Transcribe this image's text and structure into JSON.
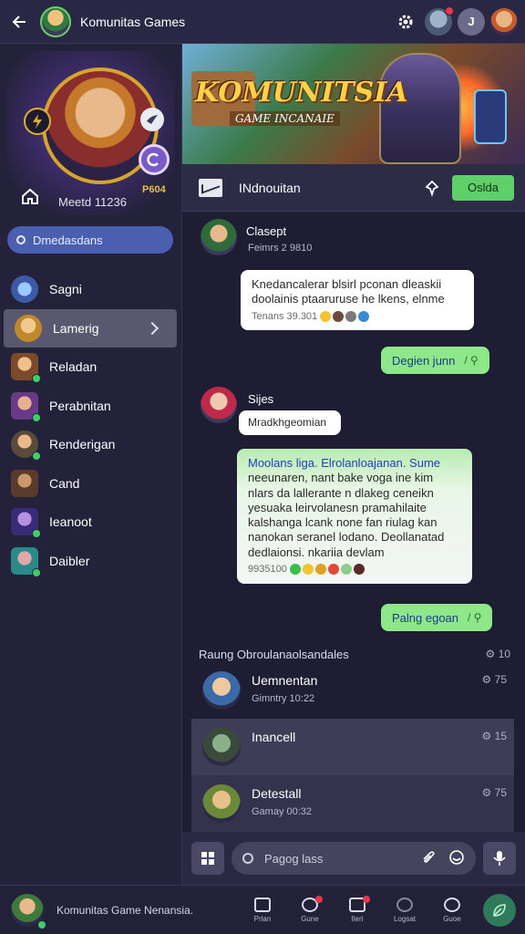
{
  "topbar": {
    "title": "Komunitas Games",
    "avatar_letter": "J"
  },
  "profile": {
    "member_id": "Meetd 11236",
    "code": "P604"
  },
  "sidebar": {
    "search_label": "Dmedasdans",
    "items": [
      {
        "label": "Sagni"
      },
      {
        "label": "Lamerig"
      },
      {
        "label": "Reladan"
      },
      {
        "label": "Perabnitan"
      },
      {
        "label": "Renderigan"
      },
      {
        "label": "Cand"
      },
      {
        "label": "Ieanoot"
      },
      {
        "label": "Daibler"
      }
    ]
  },
  "banner": {
    "title": "KOMUNITSIA",
    "subtitle": "GAME INCANAIE"
  },
  "channel": {
    "name": "INdnouitan",
    "button": "Oslda"
  },
  "messages": [
    {
      "name": "Clasept",
      "meta": "Feimrs 2 9810",
      "bubble_text": "Knedancalerar blsirl pconan dleaskii doolainis ptaaruruse he lkens, elnme",
      "bubble_meta": "Tenans 39.301",
      "reply": "Degien junn"
    },
    {
      "name": "Sijes",
      "short": "Mradkhgeomian",
      "bubble_hl": "Moolans liga. Elrolanloajanan. Sume",
      "bubble_text": "neeunaren, nant bake voga ine kim nlars da lallerante n dlakeg ceneikn yesuaka leirvolanesn pramahilaite kalshanga lcank none fan riulag kan nanokan seranel lodano. Deollanatad dedlaionsi. nkariia devlam",
      "bubble_meta": "9935100",
      "reply": "Palng egoan"
    }
  ],
  "group": {
    "heading": "Raung Obroulanaolsandales",
    "count": "10",
    "rows": [
      {
        "name": "Uemnentan",
        "sub": "Gimntry 10:22",
        "count": "75"
      },
      {
        "name": "Inancell",
        "sub": "",
        "count": "15"
      },
      {
        "name": "Detestall",
        "sub": "Gamay 00:32",
        "count": "75"
      }
    ]
  },
  "composer": {
    "placeholder": "Pagog lass"
  },
  "bottomnav": {
    "title": "Komunitas Game Nenansia.",
    "items": [
      {
        "label": "Prlan"
      },
      {
        "label": "Gune"
      },
      {
        "label": "Ileri"
      },
      {
        "label": "Logsat"
      },
      {
        "label": "Guoe"
      }
    ]
  },
  "colors": {
    "accent_green": "#5fd068",
    "search_blue": "#4b5fb0",
    "bg": "#1f1d33"
  }
}
